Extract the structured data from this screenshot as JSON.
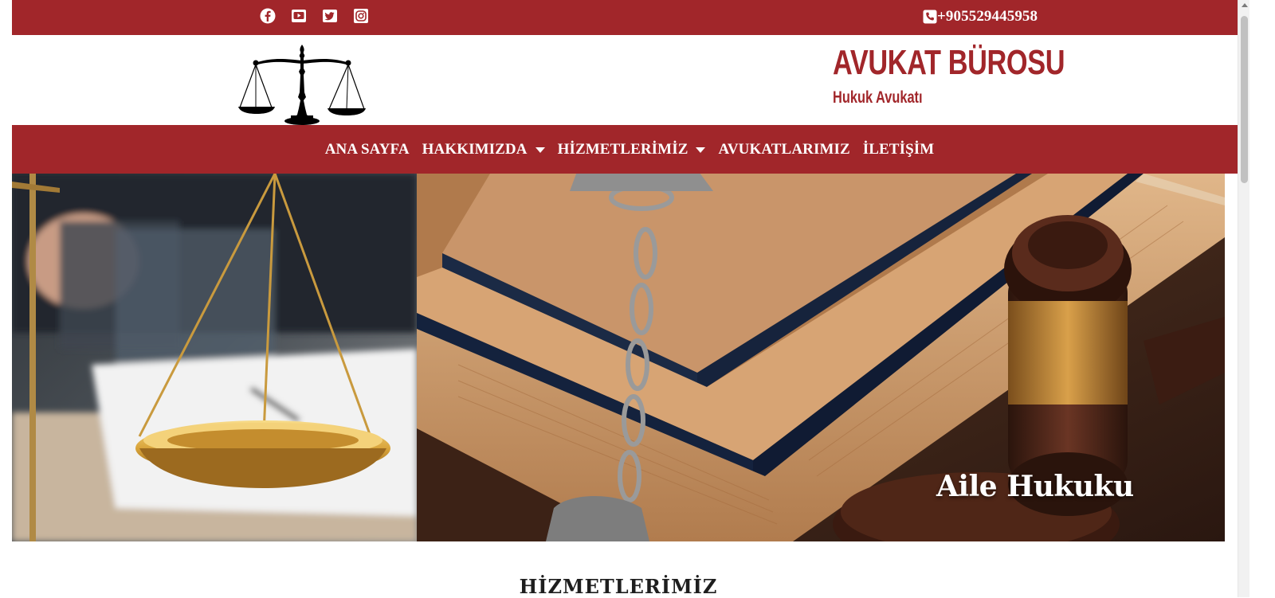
{
  "topbar": {
    "social": [
      {
        "icon": "facebook-icon"
      },
      {
        "icon": "youtube-icon"
      },
      {
        "icon": "twitter-icon"
      },
      {
        "icon": "instagram-icon"
      }
    ],
    "phone_icon": "phone-icon",
    "phone": "+905529445958"
  },
  "header": {
    "logo_icon": "scales-of-justice-logo",
    "title": "AVUKAT BÜROSU",
    "subtitle": "Hukuk Avukatı"
  },
  "nav": {
    "items": [
      {
        "label": "ANA SAYFA",
        "dropdown": false
      },
      {
        "label": "HAKKIMIZDA",
        "dropdown": true
      },
      {
        "label": "HİZMETLERİMİZ",
        "dropdown": true
      },
      {
        "label": "AVUKATLARIMIZ",
        "dropdown": false
      },
      {
        "label": "İLETİŞİM",
        "dropdown": false
      }
    ]
  },
  "hero": {
    "caption": "Aile Hukuku"
  },
  "section": {
    "title": "HİZMETLERİMİZ"
  },
  "colors": {
    "brand": "#a1262a",
    "white": "#ffffff"
  }
}
